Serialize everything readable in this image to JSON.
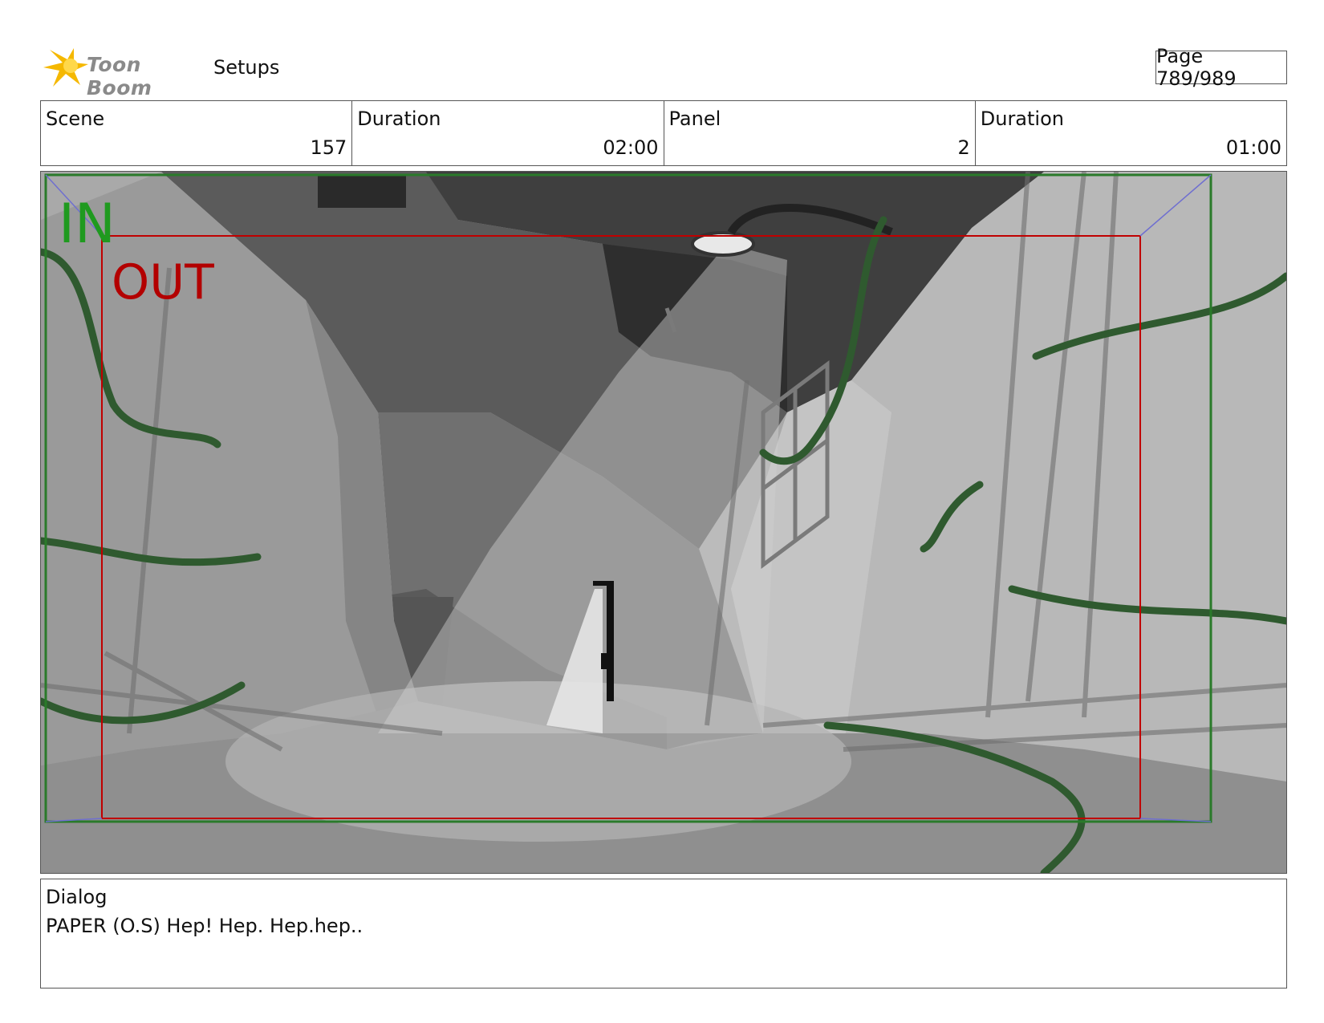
{
  "header": {
    "logo_text": "Toon Boom",
    "section": "Setups",
    "page": "Page 789/989"
  },
  "info": {
    "scene_label": "Scene",
    "scene_value": "157",
    "scene_duration_label": "Duration",
    "scene_duration_value": "02:00",
    "panel_label": "Panel",
    "panel_value": "2",
    "panel_duration_label": "Duration",
    "panel_duration_value": "01:00"
  },
  "frame": {
    "in_label": "IN",
    "out_label": "OUT",
    "in_color": "#1f9a1f",
    "out_color": "#b30000"
  },
  "dialog": {
    "label": "Dialog",
    "text": "PAPER (O.S) Hep! Hep. Hep.hep.."
  }
}
